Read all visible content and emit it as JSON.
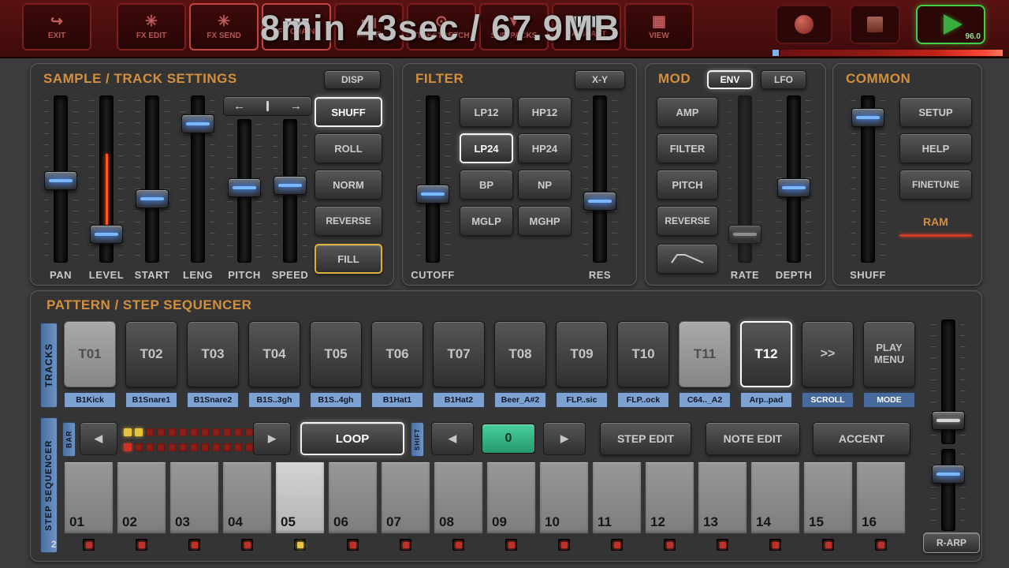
{
  "overlay": {
    "recording_text": "8min 43sec / 67.9MB"
  },
  "topbar": {
    "buttons": [
      {
        "label": "EXIT"
      },
      {
        "label": "FX EDIT"
      },
      {
        "label": "FX SEND"
      },
      {
        "label": "FX CHAIN"
      },
      {
        "label": "MIXER"
      },
      {
        "label": "TIMESTRETCH"
      },
      {
        "label": "SND-PACKS"
      },
      {
        "label": "VA-BEAST"
      },
      {
        "label": "VIEW"
      }
    ],
    "bpm": "96.0"
  },
  "icons": {
    "pager_left": "←",
    "pager_right": "→",
    "step_left": "◀",
    "step_right": "▶"
  },
  "sample": {
    "title": "SAMPLE / TRACK SETTINGS",
    "disp": "DISP",
    "faders": [
      {
        "label": "PAN",
        "pos": 51
      },
      {
        "label": "LEVEL",
        "pos": 83
      },
      {
        "label": "START",
        "pos": 62
      },
      {
        "label": "LENG",
        "pos": 17
      },
      {
        "label": "PITCH",
        "pos": 48
      },
      {
        "label": "SPEED",
        "pos": 46
      }
    ],
    "shuff": "SHUFF",
    "roll": "ROLL",
    "norm": "NORM",
    "reverse": "REVERSE",
    "fill": "FILL",
    "active_button": "SHUFF"
  },
  "filter": {
    "title": "FILTER",
    "xy": "X-Y",
    "types": [
      "LP12",
      "HP12",
      "LP24",
      "HP24",
      "BP",
      "NP",
      "MGLP",
      "MGHP"
    ],
    "selected_type": "LP24",
    "cutoff": {
      "label": "CUTOFF",
      "pos": 59
    },
    "res": {
      "label": "RES",
      "pos": 63
    }
  },
  "mod": {
    "title": "MOD",
    "env": "ENV",
    "lfo": "LFO",
    "selected_tab": "ENV",
    "amp": "AMP",
    "filter": "FILTER",
    "pitch": "PITCH",
    "reverse": "REVERSE",
    "rate": {
      "label": "RATE",
      "pos": 83
    },
    "depth": {
      "label": "DEPTH",
      "pos": 55
    }
  },
  "common": {
    "title": "COMMON",
    "setup": "SETUP",
    "help": "HELP",
    "finetune": "FINETUNE",
    "ram": "RAM",
    "shuff": {
      "label": "SHUFF",
      "pos": 13
    }
  },
  "pattern": {
    "title": "PATTERN / STEP SEQUENCER",
    "tracks_label": "TRACKS",
    "tracks": [
      {
        "label": "T01",
        "name": "B1Kick",
        "state": "lit"
      },
      {
        "label": "T02",
        "name": "B1Snare1",
        "state": ""
      },
      {
        "label": "T03",
        "name": "B1Snare2",
        "state": ""
      },
      {
        "label": "T04",
        "name": "B1S..3gh",
        "state": ""
      },
      {
        "label": "T05",
        "name": "B1S..4gh",
        "state": ""
      },
      {
        "label": "T06",
        "name": "B1Hat1",
        "state": ""
      },
      {
        "label": "T07",
        "name": "B1Hat2",
        "state": ""
      },
      {
        "label": "T08",
        "name": "Beer_A#2",
        "state": ""
      },
      {
        "label": "T09",
        "name": "FLP..sic",
        "state": ""
      },
      {
        "label": "T10",
        "name": "FLP..ock",
        "state": ""
      },
      {
        "label": "T11",
        "name": "C64.._A2",
        "state": "lit"
      },
      {
        "label": "T12",
        "name": "Arp..pad",
        "state": "selected"
      }
    ],
    "scroll": {
      "label": ">>",
      "name": "SCROLL"
    },
    "play_menu": {
      "label": "PLAY MENU",
      "name": "MODE"
    }
  },
  "sequencer": {
    "side_label": "STEP SEQUENCER",
    "bar_label": "BAR",
    "loop": "LOOP",
    "shift_label": "SHIFT",
    "shift_value": "0",
    "step_edit": "STEP EDIT",
    "note_edit": "NOTE EDIT",
    "accent": "ACCENT",
    "steps": [
      "01",
      "02",
      "03",
      "04",
      "05",
      "06",
      "07",
      "08",
      "09",
      "10",
      "11",
      "12",
      "13",
      "14",
      "15",
      "16"
    ],
    "current_step_index": 4,
    "step_leds": [
      "r",
      "r",
      "r",
      "r",
      "y",
      "r",
      "r",
      "r",
      "r",
      "r",
      "r",
      "r",
      "r",
      "r",
      "r",
      "r"
    ],
    "bar_leds": [
      [
        "y",
        "y",
        "r",
        "r",
        "r",
        "r",
        "r",
        "r",
        "r",
        "r",
        "r",
        "r"
      ],
      [
        "R",
        "r",
        "r",
        "r",
        "r",
        "r",
        "r",
        "r",
        "r",
        "r",
        "r",
        "r"
      ]
    ],
    "page_indicator": "2",
    "r_arp": "R-ARP",
    "right_fader_top": {
      "pos": 81
    },
    "right_fader_bottom": {
      "pos": 31
    }
  }
}
